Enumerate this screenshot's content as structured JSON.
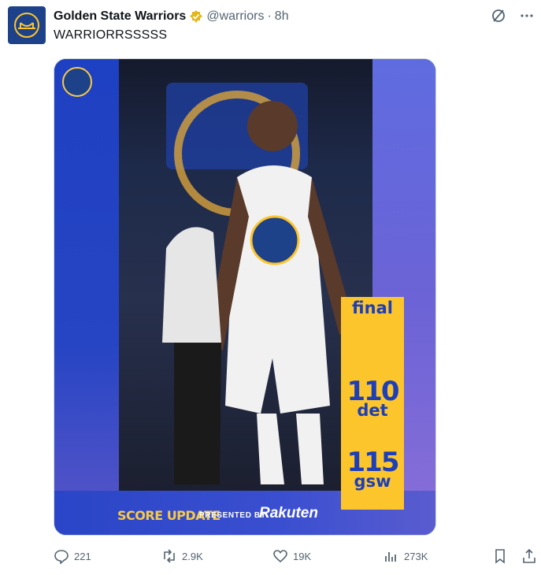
{
  "author": {
    "display_name": "Golden State Warriors",
    "handle": "@warriors",
    "separator": "·",
    "time": "8h"
  },
  "tweet": {
    "text": "WARRIORRSSSSS"
  },
  "graphic": {
    "final_label": "final",
    "teams": [
      {
        "score": "110",
        "abbr": "det"
      },
      {
        "score": "115",
        "abbr": "gsw"
      }
    ],
    "banner_text": "SCORE UPDATE",
    "presented_text": "PRESENTED BY",
    "sponsor": "Rakuten",
    "colors": {
      "gold": "#fdc52c",
      "blue": "#1d3fb8"
    }
  },
  "stats": {
    "replies": "221",
    "reposts": "2.9K",
    "likes": "19K",
    "views": "273K"
  },
  "icons": [
    "grok-icon",
    "more-icon",
    "verified-badge-icon",
    "reply-icon",
    "repost-icon",
    "like-icon",
    "views-icon",
    "bookmark-icon",
    "share-icon"
  ]
}
